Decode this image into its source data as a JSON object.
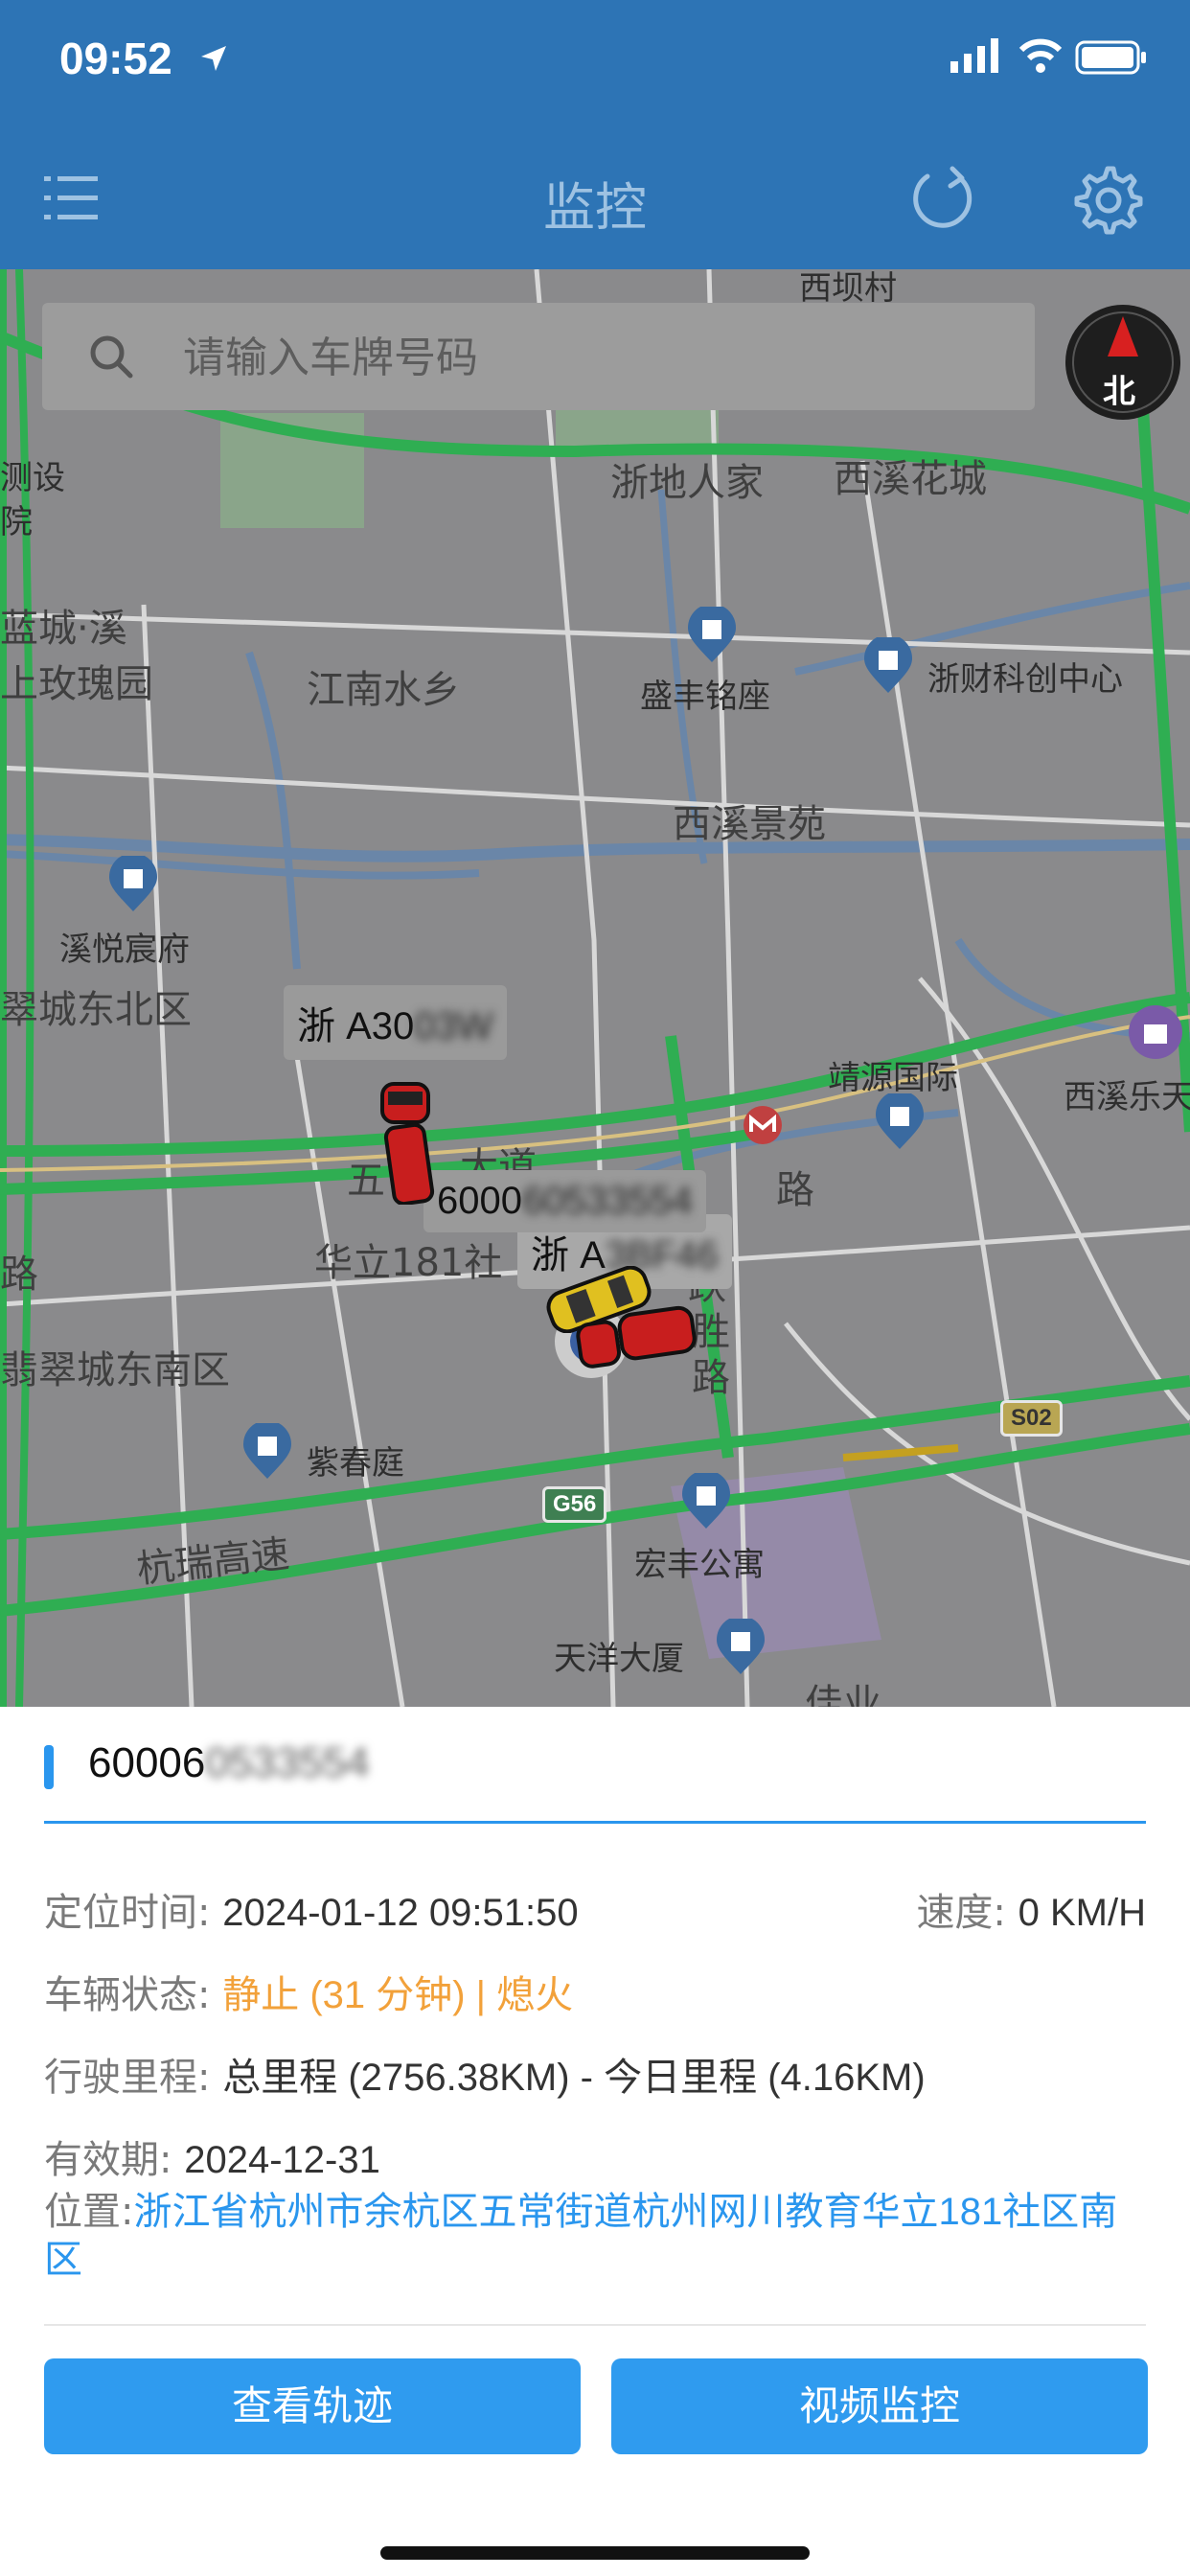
{
  "status_bar": {
    "time": "09:52"
  },
  "nav": {
    "title": "监控",
    "menu_icon": "list-icon",
    "refresh_icon": "refresh-icon",
    "settings_icon": "gear-icon"
  },
  "search": {
    "placeholder": "请输入车牌号码"
  },
  "compass": {
    "label": "北"
  },
  "map": {
    "labels": {
      "xitou": "西坝村",
      "zhedi": "浙地人家",
      "xixi_huacheng": "西溪花城",
      "ceshe": "测设",
      "yuan": "院",
      "lancheng": "蓝城·溪",
      "meigui": "上玫瑰园",
      "jiangnan": "江南水乡",
      "shengfeng": "盛丰铭座",
      "zhecai": "浙财科创中心",
      "xixi_jingyuan": "西溪景苑",
      "xiyue": "溪悦宸府",
      "cuicheng_dongbei": "翠城东北区",
      "jingyuan": "靖源国际",
      "xixi_le": "西溪乐天",
      "wuchang": "五",
      "wuchang_dao": "大道",
      "lu1": "路",
      "huali": "华立181社",
      "lu2": "路",
      "yuesheng": "跃",
      "yuesheng2": "胜",
      "yuesheng3": "路",
      "cuicheng_dongnan": "翡翠城东南区",
      "zichun": "紫春庭",
      "hangrui": "杭瑞高速",
      "hongfeng": "宏丰公寓",
      "tianyang": "天洋大厦",
      "jiaye": "佳业"
    },
    "road_badges": {
      "s02": "S02",
      "g56": "G56"
    },
    "vehicle_tags": [
      {
        "visible": "浙 A30",
        "blurred": "03W"
      },
      {
        "visible": "6000",
        "blurred": "60533554"
      },
      {
        "visible": "浙 A",
        "blurred": "3BF46"
      }
    ]
  },
  "panel": {
    "plate_visible": "60006",
    "plate_blurred": "0533554",
    "locate_time_label": "定位时间:",
    "locate_time": "2024-01-12 09:51:50",
    "speed_label": "速度:",
    "speed": "0 KM/H",
    "status_label": "车辆状态:",
    "status": "静止 (31 分钟) | 熄火",
    "mileage_label": "行驶里程:",
    "mileage": "总里程 (2756.38KM) - 今日里程 (4.16KM)",
    "expiry_label": "有效期:",
    "expiry": "2024-12-31",
    "address_label": "位置:",
    "address": "浙江省杭州市余杭区五常街道杭州网川教育华立181社区南区",
    "btn_track": "查看轨迹",
    "btn_video": "视频监控"
  },
  "colors": {
    "nav_bg": "#2d74b5",
    "accent_blue": "#2a96ee",
    "status_orange": "#f2a13a",
    "road_green": "#2fae52",
    "vehicle_red": "#c81e1e",
    "vehicle_yellow": "#e0c020"
  }
}
